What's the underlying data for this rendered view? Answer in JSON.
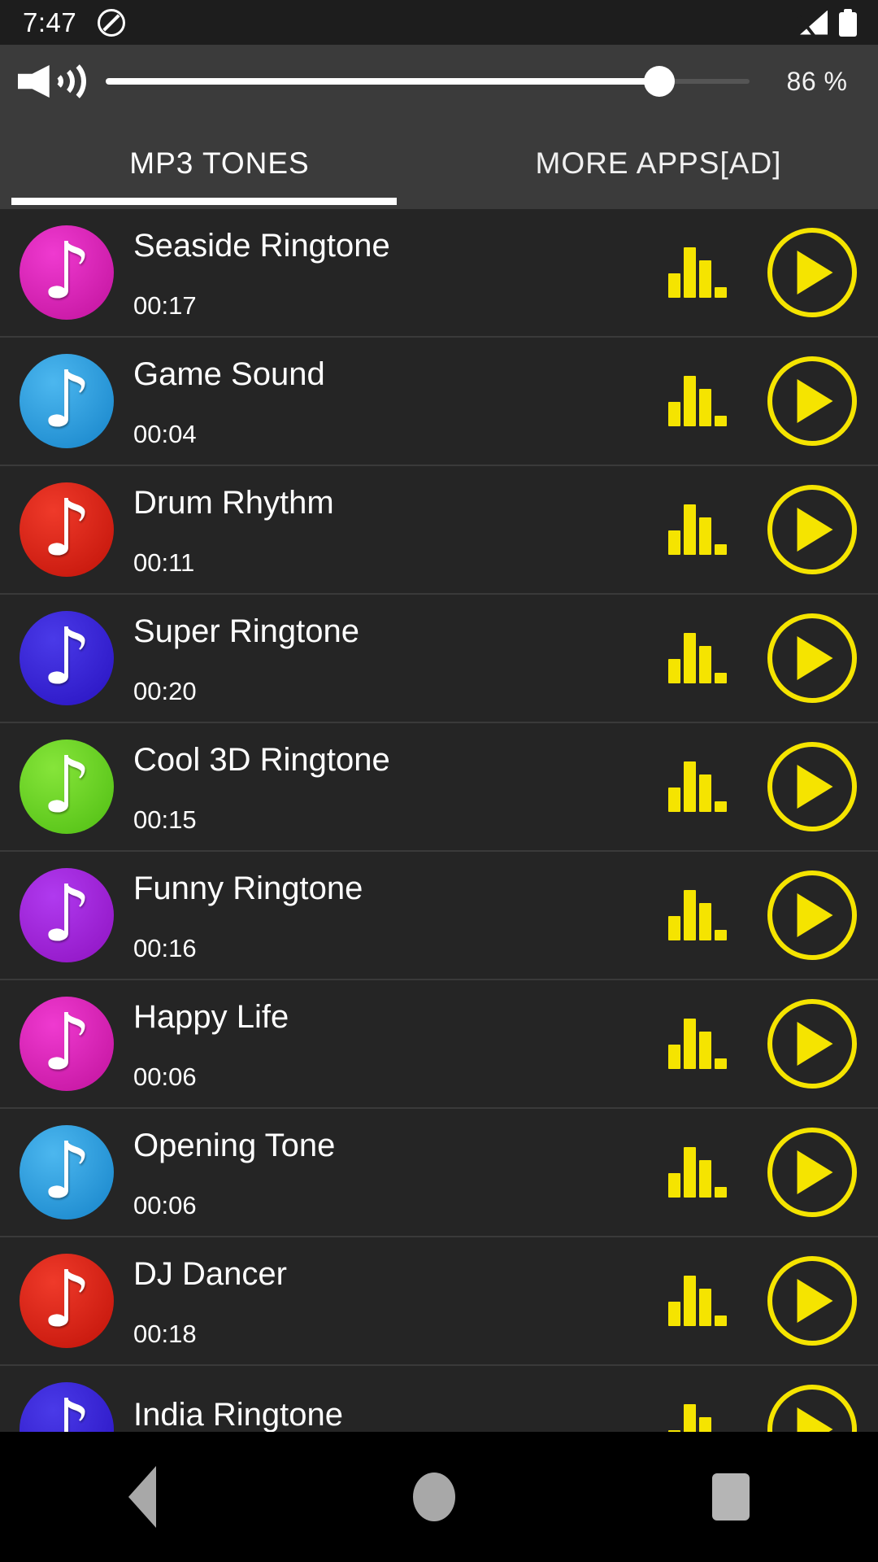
{
  "status_bar": {
    "time": "7:47",
    "dnd_icon": "do-not-disturb-icon",
    "signal_icon": "signal-no-service-icon",
    "battery_icon": "battery-full-icon"
  },
  "volume_bar": {
    "speaker_icon": "speaker-volume-icon",
    "percent_label": "86 %",
    "percent_value": 86
  },
  "tabs": [
    {
      "label": "MP3 TONES",
      "active": true
    },
    {
      "label": "MORE APPS[AD]",
      "active": false
    }
  ],
  "colors": {
    "accent_yellow": "#f5e400",
    "list_background": "#252525",
    "header_background": "#3b3b3b",
    "status_background": "#1d1d1d",
    "divider": "#3a3a3a"
  },
  "list": {
    "eq_icon": "equalizer-bars-icon",
    "play_icon": "play-circle-icon",
    "note_icon": "music-note-icon",
    "note_glyph": "♪",
    "items": [
      {
        "title": "Seaside Ringtone",
        "duration": "00:17",
        "color_start": "#ef3ad0",
        "color_end": "#c0129c"
      },
      {
        "title": "Game Sound",
        "duration": "00:04",
        "color_start": "#4cb7ef",
        "color_end": "#1583c9"
      },
      {
        "title": "Drum Rhythm",
        "duration": "00:11",
        "color_start": "#ef3a2a",
        "color_end": "#c01208"
      },
      {
        "title": "Super Ringtone",
        "duration": "00:20",
        "color_start": "#4a3ae8",
        "color_end": "#2812c0"
      },
      {
        "title": "Cool 3D Ringtone",
        "duration": "00:15",
        "color_start": "#86e53a",
        "color_end": "#4fbd12"
      },
      {
        "title": "Funny Ringtone",
        "duration": "00:16",
        "color_start": "#b03aef",
        "color_end": "#8e12c0"
      },
      {
        "title": "Happy Life",
        "duration": "00:06",
        "color_start": "#ef3ad0",
        "color_end": "#c0129c"
      },
      {
        "title": "Opening Tone",
        "duration": "00:06",
        "color_start": "#4cb7ef",
        "color_end": "#1583c9"
      },
      {
        "title": "DJ Dancer",
        "duration": "00:18",
        "color_start": "#ef3a2a",
        "color_end": "#c01208"
      },
      {
        "title": "India Ringtone",
        "duration": "",
        "color_start": "#4a3ae8",
        "color_end": "#2812c0"
      }
    ]
  },
  "nav_bar": {
    "back_icon": "back-triangle-icon",
    "home_icon": "home-circle-icon",
    "recents_icon": "recents-square-icon"
  }
}
